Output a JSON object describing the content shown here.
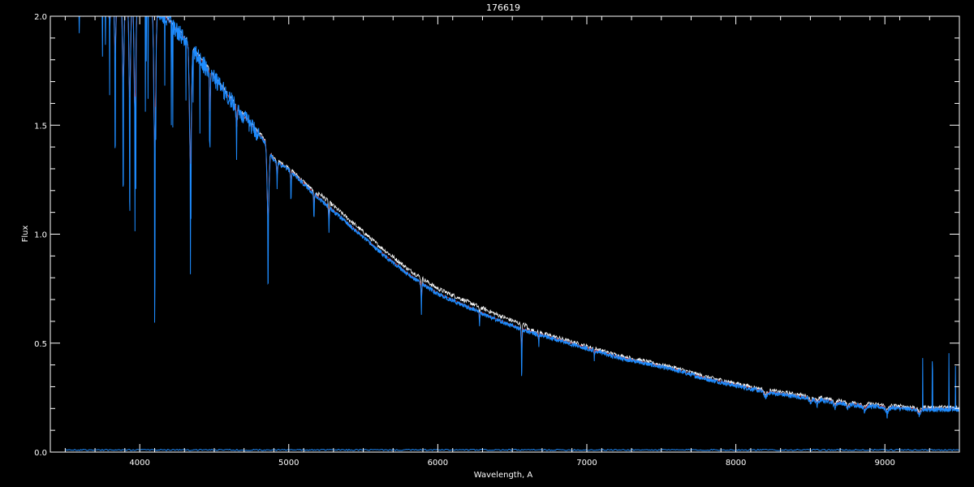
{
  "chart_data": {
    "type": "line",
    "title": "176619",
    "xlabel": "Wavelength, A",
    "ylabel": "Flux",
    "xlim": [
      3400,
      9500
    ],
    "ylim": [
      0.0,
      2.0
    ],
    "x_ticks": [
      4000,
      5000,
      6000,
      7000,
      8000,
      9000
    ],
    "x_tick_labels": [
      "4000",
      "5000",
      "6000",
      "7000",
      "8000",
      "9000"
    ],
    "y_ticks": [
      0.0,
      0.5,
      1.0,
      1.5,
      2.0
    ],
    "y_tick_labels": [
      "0.0",
      "0.5",
      "1.0",
      "1.5",
      "2.0"
    ],
    "grid": false,
    "background": "#000000",
    "colors": {
      "observed": "#ffffff",
      "model": "#cc2020",
      "spectrum": "#1e8cff",
      "axes": "#ffffff"
    },
    "continuum": {
      "x": [
        3500,
        3700,
        3900,
        4100,
        4300,
        4500,
        4700,
        4850,
        4900,
        5000,
        5200,
        5400,
        5600,
        5800,
        6000,
        6200,
        6400,
        6550,
        6600,
        6800,
        7000,
        7200,
        7400,
        7600,
        7800,
        8000,
        8200,
        8400,
        8600,
        8800,
        9000,
        9200,
        9400,
        9500
      ],
      "y": [
        2.6,
        2.4,
        2.2,
        2.05,
        1.9,
        1.72,
        1.54,
        1.42,
        1.34,
        1.3,
        1.17,
        1.05,
        0.93,
        0.82,
        0.73,
        0.67,
        0.61,
        0.57,
        0.56,
        0.52,
        0.48,
        0.44,
        0.41,
        0.38,
        0.34,
        0.31,
        0.28,
        0.26,
        0.24,
        0.22,
        0.21,
        0.2,
        0.2,
        0.2
      ]
    },
    "absorption_lines": [
      {
        "x": 3750,
        "depth": 0.5
      },
      {
        "x": 3770,
        "depth": 0.4
      },
      {
        "x": 3798,
        "depth": 0.6
      },
      {
        "x": 3835,
        "depth": 0.8
      },
      {
        "x": 3889,
        "depth": 0.95
      },
      {
        "x": 3933,
        "depth": 1.0
      },
      {
        "x": 3968,
        "depth": 1.1
      },
      {
        "x": 4101,
        "depth": 1.2
      },
      {
        "x": 4340,
        "depth": 1.0
      },
      {
        "x": 4471,
        "depth": 0.35
      },
      {
        "x": 4650,
        "depth": 0.2
      },
      {
        "x": 4861,
        "depth": 0.6
      },
      {
        "x": 4922,
        "depth": 0.12
      },
      {
        "x": 5015,
        "depth": 0.12
      },
      {
        "x": 5169,
        "depth": 0.1
      },
      {
        "x": 5270,
        "depth": 0.12
      },
      {
        "x": 5890,
        "depth": 0.14
      },
      {
        "x": 6280,
        "depth": 0.06
      },
      {
        "x": 6563,
        "depth": 0.2
      },
      {
        "x": 6678,
        "depth": 0.05
      },
      {
        "x": 7050,
        "depth": 0.04
      },
      {
        "x": 8200,
        "depth": 0.04
      },
      {
        "x": 8500,
        "depth": 0.03
      },
      {
        "x": 8545,
        "depth": 0.03
      },
      {
        "x": 8665,
        "depth": 0.03
      },
      {
        "x": 8750,
        "depth": 0.03
      },
      {
        "x": 8863,
        "depth": 0.03
      },
      {
        "x": 9015,
        "depth": 0.04
      },
      {
        "x": 9230,
        "depth": 0.04
      }
    ],
    "series": [
      {
        "role": "observed"
      },
      {
        "role": "model"
      },
      {
        "role": "spectrum"
      }
    ]
  }
}
